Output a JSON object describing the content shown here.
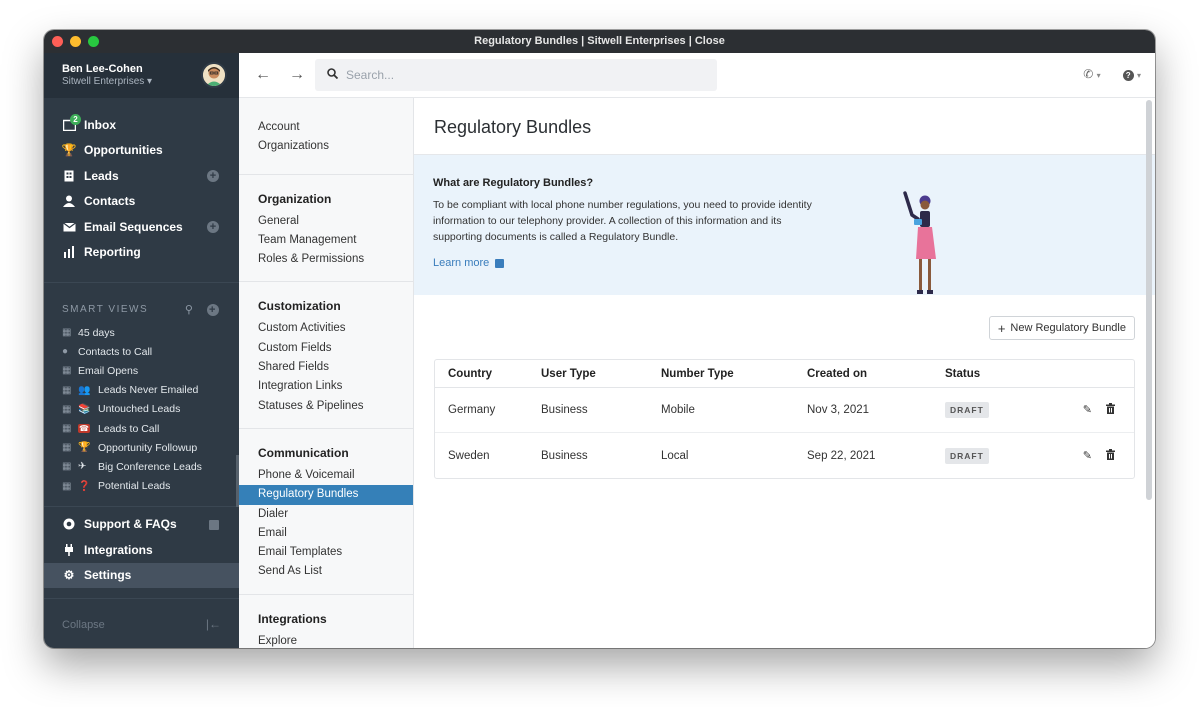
{
  "window": {
    "title": "Regulatory Bundles | Sitwell Enterprises | Close"
  },
  "user": {
    "name": "Ben Lee-Cohen",
    "org": "Sitwell Enterprises",
    "org_caret": "▾"
  },
  "nav": {
    "items": [
      {
        "label": "Inbox",
        "icon": "inbox-icon",
        "badge": "2"
      },
      {
        "label": "Opportunities",
        "icon": "trophy-icon"
      },
      {
        "label": "Leads",
        "icon": "building-icon",
        "add": true
      },
      {
        "label": "Contacts",
        "icon": "person-icon"
      },
      {
        "label": "Email Sequences",
        "icon": "sequence-icon",
        "add": true
      },
      {
        "label": "Reporting",
        "icon": "chart-icon"
      }
    ],
    "smart_views_label": "SMART VIEWS",
    "smart_views": [
      {
        "label": "45 days",
        "emoji": ""
      },
      {
        "label": "Contacts to Call",
        "emoji": ""
      },
      {
        "label": "Email Opens",
        "emoji": ""
      },
      {
        "label": "Leads Never Emailed",
        "emoji": "👥"
      },
      {
        "label": "Untouched Leads",
        "emoji": "📚"
      },
      {
        "label": "Leads to Call",
        "emoji": "☎"
      },
      {
        "label": "Opportunity Followup",
        "emoji": "🏆"
      },
      {
        "label": "Big Conference Leads",
        "emoji": "✈"
      },
      {
        "label": "Potential Leads",
        "emoji": "❓"
      }
    ],
    "bottom_items": [
      {
        "label": "Support & FAQs",
        "icon": "support-icon"
      },
      {
        "label": "Integrations",
        "icon": "plug-icon"
      },
      {
        "label": "Settings",
        "icon": "gear-icon",
        "active": true
      }
    ],
    "collapse_label": "Collapse"
  },
  "search": {
    "placeholder": "Search..."
  },
  "settings_nav": {
    "top": [
      "Account",
      "Organizations"
    ],
    "groups": [
      {
        "title": "Organization",
        "items": [
          "General",
          "Team Management",
          "Roles & Permissions"
        ]
      },
      {
        "title": "Customization",
        "items": [
          "Custom Activities",
          "Custom Fields",
          "Shared Fields",
          "Integration Links",
          "Statuses & Pipelines"
        ]
      },
      {
        "title": "Communication",
        "items": [
          "Phone & Voicemail",
          "Regulatory Bundles",
          "Dialer",
          "Email",
          "Email Templates",
          "Send As List"
        ],
        "active": "Regulatory Bundles"
      },
      {
        "title": "Integrations",
        "items": [
          "Explore"
        ]
      }
    ]
  },
  "main": {
    "title": "Regulatory Bundles",
    "info": {
      "title": "What are Regulatory Bundles?",
      "text": "To be compliant with local phone number regulations, you need to provide identity information to our telephony provider. A collection of this information and its supporting documents is called a Regulatory Bundle.",
      "link": "Learn more"
    },
    "new_button": "New Regulatory Bundle",
    "table": {
      "headers": [
        "Country",
        "User Type",
        "Number Type",
        "Created on",
        "Status"
      ],
      "rows": [
        [
          "Germany",
          "Business",
          "Mobile",
          "Nov 3, 2021",
          "DRAFT"
        ],
        [
          "Sweden",
          "Business",
          "Local",
          "Sep 22, 2021",
          "DRAFT"
        ]
      ]
    }
  },
  "colors": {
    "sidebar": "#2f3a45",
    "active_nav": "#3580b8",
    "info_bg": "#eaf3fb",
    "link": "#3a7dbc",
    "badge": "#3fae5a"
  }
}
